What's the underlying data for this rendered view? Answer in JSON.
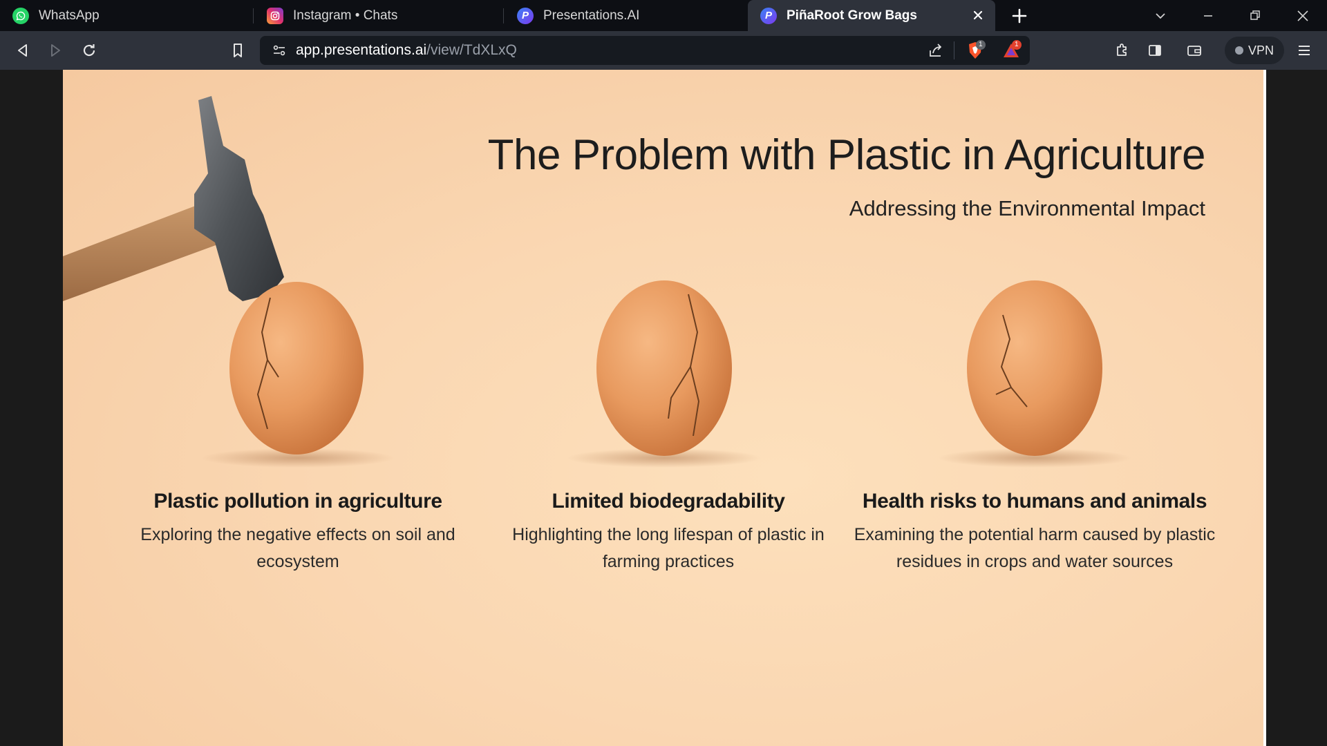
{
  "browser": {
    "tabs": [
      {
        "label": "WhatsApp",
        "icon": "whatsapp-icon",
        "active": false
      },
      {
        "label": "Instagram • Chats",
        "icon": "instagram-icon",
        "active": false
      },
      {
        "label": "Presentations.AI",
        "icon": "presentations-ai-icon",
        "active": false
      },
      {
        "label": "PiñaRoot Grow Bags",
        "icon": "presentations-ai-icon",
        "active": true
      }
    ],
    "url": {
      "domain": "app.presentations.ai",
      "path": "/view/TdXLxQ"
    },
    "brave_shields_count": "1",
    "rewards_count": "1",
    "vpn_label": "VPN"
  },
  "slide": {
    "title": "The Problem with Plastic in Agriculture",
    "subtitle": "Addressing the Environmental Impact",
    "columns": [
      {
        "heading": "Plastic pollution in agriculture",
        "body": "Exploring the negative effects on soil and ecosystem"
      },
      {
        "heading": "Limited biodegradability",
        "body": "Highlighting the long lifespan of plastic in farming practices"
      },
      {
        "heading": "Health risks to humans and animals",
        "body": "Examining the potential harm caused by plastic residues in crops and water sources"
      }
    ]
  },
  "colors": {
    "tabstrip_bg": "#0d0f14",
    "toolbar_bg": "#2e323b",
    "slide_bg": "#fad7b2",
    "egg": "#e89a5f"
  }
}
